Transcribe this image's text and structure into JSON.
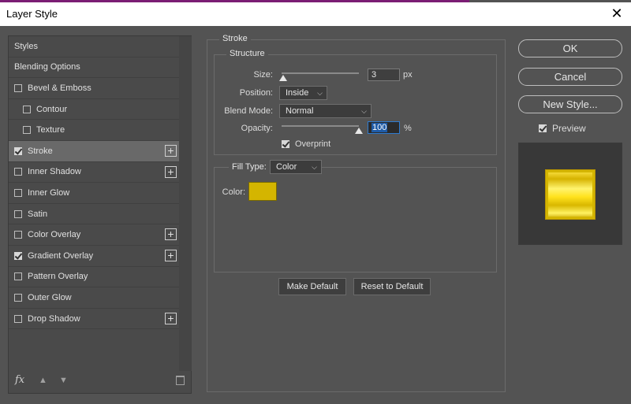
{
  "window": {
    "title": "Layer Style",
    "close_glyph": "✕"
  },
  "sidebar": {
    "items": [
      {
        "label": "Styles",
        "checkbox": false,
        "checked": false,
        "plus": false,
        "selected": false,
        "indent": false
      },
      {
        "label": "Blending Options",
        "checkbox": false,
        "checked": false,
        "plus": false,
        "selected": false,
        "indent": false
      },
      {
        "label": "Bevel & Emboss",
        "checkbox": true,
        "checked": false,
        "plus": false,
        "selected": false,
        "indent": false
      },
      {
        "label": "Contour",
        "checkbox": true,
        "checked": false,
        "plus": false,
        "selected": false,
        "indent": true
      },
      {
        "label": "Texture",
        "checkbox": true,
        "checked": false,
        "plus": false,
        "selected": false,
        "indent": true
      },
      {
        "label": "Stroke",
        "checkbox": true,
        "checked": true,
        "plus": true,
        "selected": true,
        "indent": false
      },
      {
        "label": "Inner Shadow",
        "checkbox": true,
        "checked": false,
        "plus": true,
        "selected": false,
        "indent": false
      },
      {
        "label": "Inner Glow",
        "checkbox": true,
        "checked": false,
        "plus": false,
        "selected": false,
        "indent": false
      },
      {
        "label": "Satin",
        "checkbox": true,
        "checked": false,
        "plus": false,
        "selected": false,
        "indent": false
      },
      {
        "label": "Color Overlay",
        "checkbox": true,
        "checked": false,
        "plus": true,
        "selected": false,
        "indent": false
      },
      {
        "label": "Gradient Overlay",
        "checkbox": true,
        "checked": true,
        "plus": true,
        "selected": false,
        "indent": false
      },
      {
        "label": "Pattern Overlay",
        "checkbox": true,
        "checked": false,
        "plus": false,
        "selected": false,
        "indent": false
      },
      {
        "label": "Outer Glow",
        "checkbox": true,
        "checked": false,
        "plus": false,
        "selected": false,
        "indent": false
      },
      {
        "label": "Drop Shadow",
        "checkbox": true,
        "checked": false,
        "plus": true,
        "selected": false,
        "indent": false
      }
    ],
    "plus_glyph": "+",
    "fx_label": "fx",
    "up_glyph": "▲",
    "down_glyph": "▼"
  },
  "stroke": {
    "group_title": "Stroke",
    "structure_title": "Structure",
    "size_label": "Size:",
    "size_value": "3",
    "size_unit": "px",
    "size_fraction": 0.02,
    "position_label": "Position:",
    "position_value": "Inside",
    "blend_label": "Blend Mode:",
    "blend_value": "Normal",
    "opacity_label": "Opacity:",
    "opacity_value": "100",
    "opacity_unit": "%",
    "opacity_fraction": 1.0,
    "overprint_label": "Overprint",
    "overprint_checked": true,
    "fill_type_label": "Fill Type:",
    "fill_type_value": "Color",
    "color_label": "Color:",
    "color_value": "#d4b500",
    "make_default": "Make Default",
    "reset_default": "Reset to Default"
  },
  "actions": {
    "ok": "OK",
    "cancel": "Cancel",
    "new_style": "New Style...",
    "preview_label": "Preview",
    "preview_checked": true
  },
  "colors": {
    "accent_purple": "#7b1d74",
    "selection_blue": "#1f5ba6",
    "gold": "#d4b500"
  }
}
